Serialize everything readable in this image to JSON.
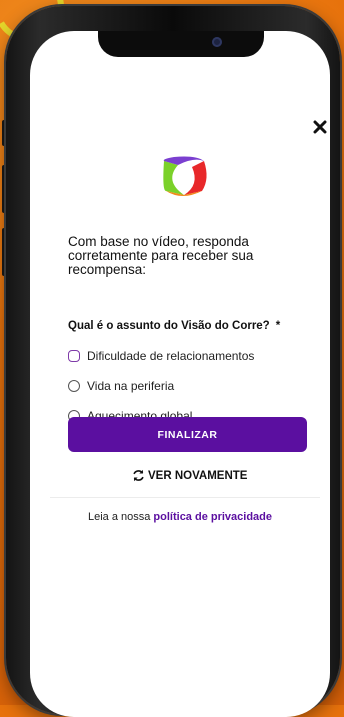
{
  "app": {
    "title": ""
  },
  "intro_text": "Com base no vídeo, responda corretamente para receber sua recompensa:",
  "question": {
    "label": "Qual é o assunto do Visão do Corre?",
    "required_mark": "*"
  },
  "options": [
    {
      "label": "Dificuldade de relacionamentos"
    },
    {
      "label": "Vida na periferia"
    },
    {
      "label": "Aquecimento global"
    }
  ],
  "submit_button": {
    "label": "FINALIZAR"
  },
  "rewatch_button": {
    "label": "VER NOVAMENTE",
    "icon": "refresh-icon"
  },
  "footer": {
    "prefix": "Leia a nossa",
    "link_label": "política de privacidade"
  },
  "close_button": {
    "icon": "close-icon",
    "glyph": "✕"
  },
  "colors": {
    "accent": "#5b0fa0",
    "background": "#e7720c",
    "logo_green": "#7bd12a",
    "logo_red": "#e8282a",
    "logo_purple": "#7b3fd0",
    "logo_orange": "#f18a1a"
  }
}
